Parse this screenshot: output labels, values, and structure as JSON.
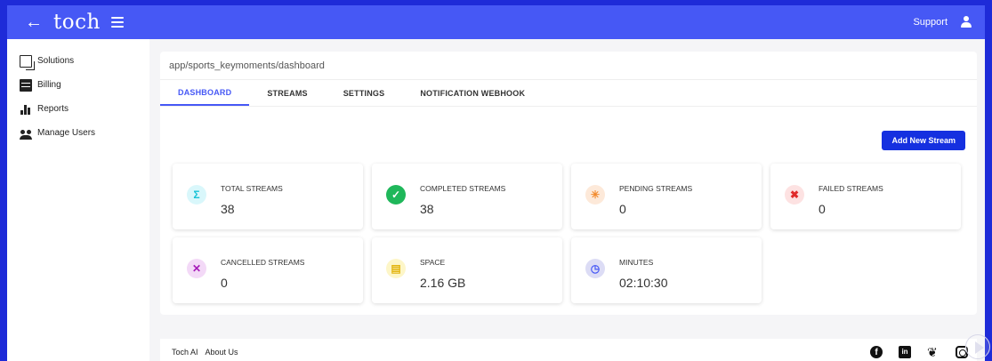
{
  "topbar": {
    "brand": "toch",
    "back_icon": "arrow-left-icon",
    "menu_icon": "hamburger-icon",
    "support_label": "Support",
    "user_icon": "user-icon",
    "bg_color": "#4658f5"
  },
  "sidebar": {
    "items": [
      {
        "label": "Solutions",
        "icon": "solutions-icon"
      },
      {
        "label": "Billing",
        "icon": "billing-icon"
      },
      {
        "label": "Reports",
        "icon": "reports-icon"
      },
      {
        "label": "Manage Users",
        "icon": "users-icon"
      }
    ]
  },
  "main": {
    "breadcrumb": "app/sports_keymoments/dashboard",
    "tabs": [
      {
        "label": "DASHBOARD",
        "active": true
      },
      {
        "label": "STREAMS",
        "active": false
      },
      {
        "label": "SETTINGS",
        "active": false
      },
      {
        "label": "NOTIFICATION WEBHOOK",
        "active": false
      }
    ],
    "add_button_label": "Add New Stream",
    "accent_color": "#4658f5",
    "stats": [
      {
        "label": "TOTAL STREAMS",
        "value": "38",
        "icon": "sigma-icon",
        "icon_bg": "#d9f7fb",
        "icon_color": "#19c3d6",
        "glyph": "Σ"
      },
      {
        "label": "COMPLETED STREAMS",
        "value": "38",
        "icon": "check-circle-icon",
        "icon_bg": "#1fb75a",
        "icon_color": "#ffffff",
        "glyph": "✓"
      },
      {
        "label": "PENDING STREAMS",
        "value": "0",
        "icon": "loading-icon",
        "icon_bg": "#fde9d9",
        "icon_color": "#f28a2c",
        "glyph": "✳"
      },
      {
        "label": "FAILED STREAMS",
        "value": "0",
        "icon": "failed-icon",
        "icon_bg": "#fde2e2",
        "icon_color": "#e02b2b",
        "glyph": "✖"
      },
      {
        "label": "CANCELLED STREAMS",
        "value": "0",
        "icon": "cancel-icon",
        "icon_bg": "#f3d9f7",
        "icon_color": "#a61ab8",
        "glyph": "✕"
      },
      {
        "label": "SPACE",
        "value": "2.16 GB",
        "icon": "storage-icon",
        "icon_bg": "#fdf6c8",
        "icon_color": "#e3b510",
        "glyph": "▤"
      },
      {
        "label": "MINUTES",
        "value": "02:10:30",
        "icon": "clock-icon",
        "icon_bg": "#dcdcf5",
        "icon_color": "#4658f5",
        "glyph": "◷"
      }
    ]
  },
  "footer": {
    "links": [
      "Toch AI",
      "About Us"
    ],
    "social": [
      "facebook-icon",
      "linkedin-icon",
      "twitter-icon",
      "instagram-icon"
    ]
  }
}
